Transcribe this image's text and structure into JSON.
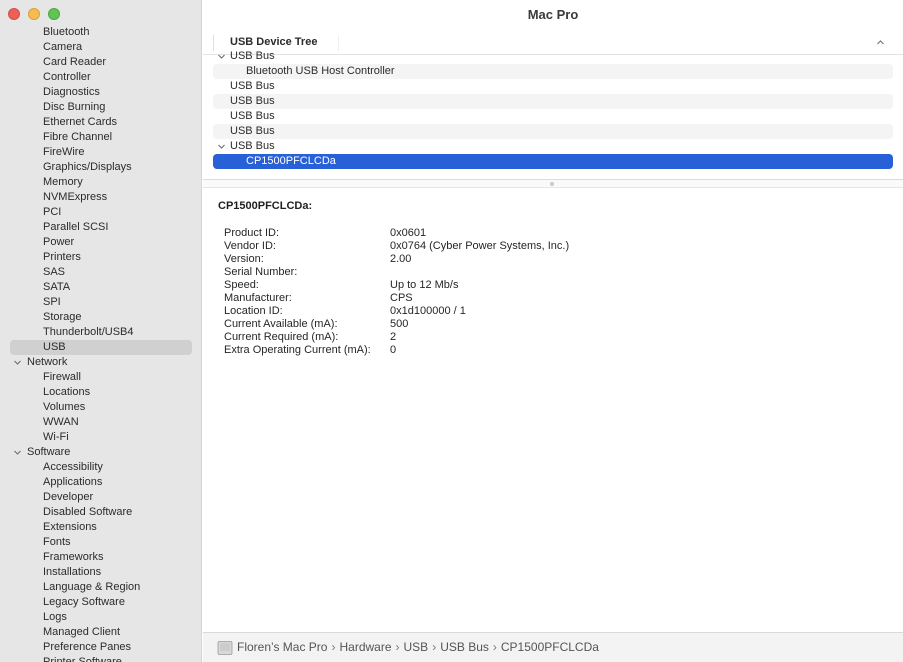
{
  "window": {
    "title": "Mac Pro"
  },
  "sidebar": {
    "rows": [
      {
        "label": "Bluetooth",
        "kind": "child"
      },
      {
        "label": "Camera",
        "kind": "child"
      },
      {
        "label": "Card Reader",
        "kind": "child"
      },
      {
        "label": "Controller",
        "kind": "child"
      },
      {
        "label": "Diagnostics",
        "kind": "child"
      },
      {
        "label": "Disc Burning",
        "kind": "child"
      },
      {
        "label": "Ethernet Cards",
        "kind": "child"
      },
      {
        "label": "Fibre Channel",
        "kind": "child"
      },
      {
        "label": "FireWire",
        "kind": "child"
      },
      {
        "label": "Graphics/Displays",
        "kind": "child"
      },
      {
        "label": "Memory",
        "kind": "child"
      },
      {
        "label": "NVMExpress",
        "kind": "child"
      },
      {
        "label": "PCI",
        "kind": "child"
      },
      {
        "label": "Parallel SCSI",
        "kind": "child"
      },
      {
        "label": "Power",
        "kind": "child"
      },
      {
        "label": "Printers",
        "kind": "child"
      },
      {
        "label": "SAS",
        "kind": "child"
      },
      {
        "label": "SATA",
        "kind": "child"
      },
      {
        "label": "SPI",
        "kind": "child"
      },
      {
        "label": "Storage",
        "kind": "child"
      },
      {
        "label": "Thunderbolt/USB4",
        "kind": "child"
      },
      {
        "label": "USB",
        "kind": "child",
        "selected": true
      },
      {
        "label": "Network",
        "kind": "group"
      },
      {
        "label": "Firewall",
        "kind": "child"
      },
      {
        "label": "Locations",
        "kind": "child"
      },
      {
        "label": "Volumes",
        "kind": "child"
      },
      {
        "label": "WWAN",
        "kind": "child"
      },
      {
        "label": "Wi-Fi",
        "kind": "child"
      },
      {
        "label": "Software",
        "kind": "group"
      },
      {
        "label": "Accessibility",
        "kind": "child"
      },
      {
        "label": "Applications",
        "kind": "child"
      },
      {
        "label": "Developer",
        "kind": "child"
      },
      {
        "label": "Disabled Software",
        "kind": "child"
      },
      {
        "label": "Extensions",
        "kind": "child"
      },
      {
        "label": "Fonts",
        "kind": "child"
      },
      {
        "label": "Frameworks",
        "kind": "child"
      },
      {
        "label": "Installations",
        "kind": "child"
      },
      {
        "label": "Language & Region",
        "kind": "child"
      },
      {
        "label": "Legacy Software",
        "kind": "child"
      },
      {
        "label": "Logs",
        "kind": "child"
      },
      {
        "label": "Managed Client",
        "kind": "child"
      },
      {
        "label": "Preference Panes",
        "kind": "child"
      },
      {
        "label": "Printer Software",
        "kind": "child"
      }
    ]
  },
  "tree": {
    "header": "USB Device Tree",
    "rows": [
      {
        "label": "USB Bus",
        "level": 0,
        "expanded": true
      },
      {
        "label": "Bluetooth USB Host Controller",
        "level": 1
      },
      {
        "label": "USB Bus",
        "level": 0
      },
      {
        "label": "USB Bus",
        "level": 0
      },
      {
        "label": "USB Bus",
        "level": 0
      },
      {
        "label": "USB Bus",
        "level": 0
      },
      {
        "label": "USB Bus",
        "level": 0,
        "expanded": true
      },
      {
        "label": "CP1500PFCLCDa",
        "level": 1,
        "selected": true
      }
    ]
  },
  "detail": {
    "title": "CP1500PFCLCDa:",
    "properties": [
      {
        "key": "Product ID:",
        "value": "0x0601"
      },
      {
        "key": "Vendor ID:",
        "value": "0x0764  (Cyber Power Systems, Inc.)"
      },
      {
        "key": "Version:",
        "value": "2.00"
      },
      {
        "key": "Serial Number:",
        "value": ""
      },
      {
        "key": "Speed:",
        "value": "Up to 12 Mb/s"
      },
      {
        "key": "Manufacturer:",
        "value": "CPS"
      },
      {
        "key": "Location ID:",
        "value": "0x1d100000 / 1"
      },
      {
        "key": "Current Available (mA):",
        "value": "500"
      },
      {
        "key": "Current Required (mA):",
        "value": "2"
      },
      {
        "key": "Extra Operating Current (mA):",
        "value": "0"
      }
    ]
  },
  "pathbar": {
    "crumbs": [
      "Floren’s Mac Pro",
      "Hardware",
      "USB",
      "USB Bus",
      "CP1500PFCLCDa"
    ],
    "separator": "›"
  },
  "colors": {
    "selection": "#2860d8",
    "sidebar_bg": "#e6e6e6"
  }
}
